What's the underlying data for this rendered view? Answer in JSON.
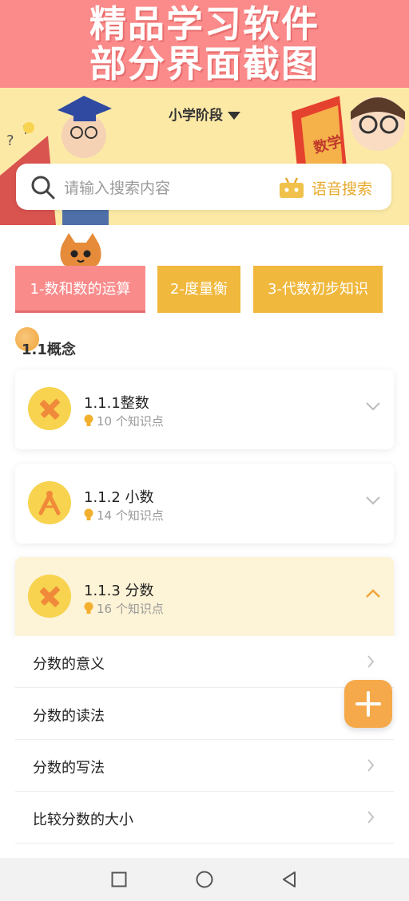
{
  "promo": {
    "line1": "精品学习软件",
    "line2": "部分界面截图"
  },
  "header": {
    "stage": "小学阶段"
  },
  "search": {
    "placeholder": "请输入搜索内容",
    "voice_label": "语音搜索"
  },
  "book_label": "数学",
  "tabs": [
    {
      "label": "1-数和数的运算",
      "active": true
    },
    {
      "label": "2-度量衡",
      "active": false
    },
    {
      "label": "3-代数初步知识",
      "active": false
    }
  ],
  "section": {
    "title": "1.1概念"
  },
  "cards": [
    {
      "title": "1.1.1整数",
      "count": "10 个知识点",
      "icon": "pencil-ruler-icon",
      "expanded": false
    },
    {
      "title": "1.1.2 小数",
      "count": "14 个知识点",
      "icon": "compass-icon",
      "expanded": false
    },
    {
      "title": "1.1.3 分数",
      "count": "16 个知识点",
      "icon": "pencil-ruler-icon",
      "expanded": true
    }
  ],
  "subitems": [
    {
      "label": "分数的意义"
    },
    {
      "label": "分数的读法"
    },
    {
      "label": "分数的写法"
    },
    {
      "label": "比较分数的大小"
    }
  ],
  "colors": {
    "accent_pink": "#fa8b8b",
    "accent_yellow": "#f0b83d",
    "fab": "#f5a94a",
    "hero_bg": "#fce9a6"
  }
}
